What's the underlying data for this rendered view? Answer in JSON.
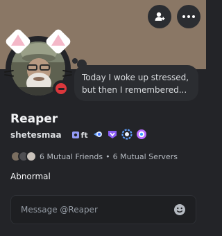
{
  "profile": {
    "display_name": "Reaper",
    "username": "shetesmaa",
    "tag": "ft",
    "status_text_line1": "Today I woke up stressed,",
    "status_text_line2": "but then I remembered...",
    "presence": "do-not-disturb",
    "about": "Abnormal"
  },
  "mutuals": {
    "friends_label": "6 Mutual Friends",
    "separator": "•",
    "servers_label": "6 Mutual Servers"
  },
  "message": {
    "placeholder": "Message @Reaper"
  },
  "icons": {
    "friend_button": "add-friend-icon",
    "more_button": "more-dots-icon",
    "emoji": "emoji-smile-icon"
  },
  "colors": {
    "banner": "#8a7765",
    "card_bg": "#232428",
    "dnd": "#da373c",
    "ear_inner": "#f4b8c8"
  }
}
